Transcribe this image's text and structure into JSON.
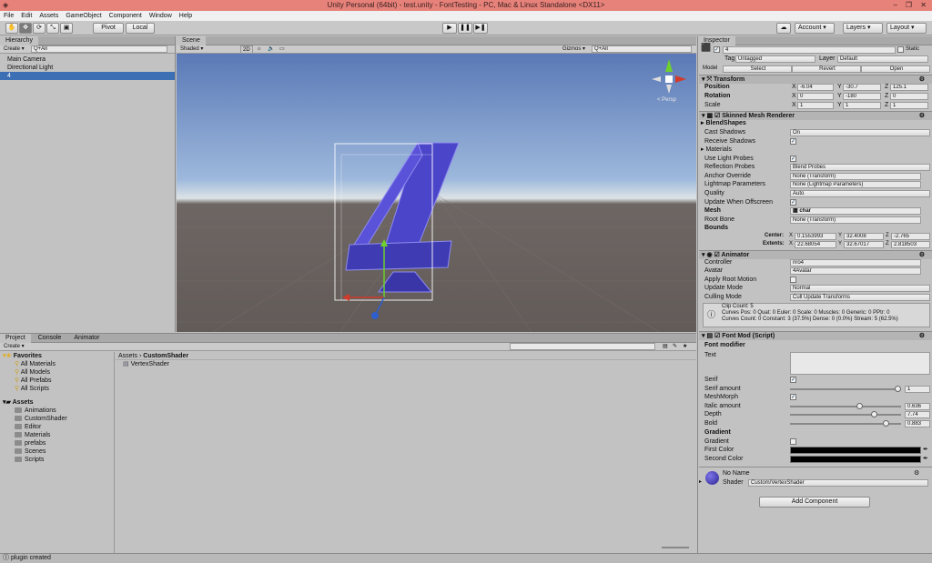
{
  "window": {
    "title": "Unity Personal (64bit) - test.unity - FontTesting - PC, Mac & Linux Standalone <DX11>"
  },
  "menu": [
    "File",
    "Edit",
    "Assets",
    "GameObject",
    "Component",
    "Window",
    "Help"
  ],
  "toolbar": {
    "pivot": "Pivot",
    "local": "Local",
    "account": "Account",
    "layers": "Layers",
    "layout": "Layout"
  },
  "hierarchy": {
    "tab": "Hierarchy",
    "create": "Create",
    "search": "Q+All",
    "items": [
      "Main Camera",
      "Directional Light",
      "4"
    ]
  },
  "scene": {
    "tab": "Scene",
    "shading": "Shaded",
    "mode2d": "2D",
    "gizmos": "Gizmos",
    "search": "Q+All",
    "persp": "< Persp"
  },
  "project": {
    "tabs": [
      "Project",
      "Console",
      "Animator"
    ],
    "create": "Create",
    "favorites_label": "Favorites",
    "favorites": [
      "All Materials",
      "All Models",
      "All Prefabs",
      "All Scripts"
    ],
    "assets_label": "Assets",
    "assets": [
      "Animations",
      "CustomShader",
      "Editor",
      "Materials",
      "prefabs",
      "Scenes",
      "Scripts"
    ],
    "breadcrumb_root": "Assets",
    "breadcrumb_sep": "›",
    "breadcrumb_folder": "CustomShader",
    "files": [
      "VertexShader"
    ]
  },
  "status": {
    "text": "plugin created"
  },
  "inspector": {
    "tab": "Inspector",
    "object_name": "4",
    "static_label": "Static",
    "tag_label": "Tag",
    "tag_value": "Untagged",
    "layer_label": "Layer",
    "layer_value": "Default",
    "model_label": "Model",
    "select": "Select",
    "revert": "Revert",
    "open": "Open",
    "transform": {
      "title": "Transform",
      "position": "Position",
      "rotation": "Rotation",
      "scale": "Scale",
      "pos": [
        "-6.04",
        "-30.7",
        "125.1"
      ],
      "rot": [
        "0",
        "-180",
        "0"
      ],
      "scl": [
        "1",
        "1",
        "1"
      ]
    },
    "smr": {
      "title": "Skinned Mesh Renderer",
      "blendshapes": "BlendShapes",
      "cast_shadows": "Cast Shadows",
      "cast_val": "On",
      "receive": "Receive Shadows",
      "materials": "Materials",
      "light_probes": "Use Light Probes",
      "refl_probes": "Reflection Probes",
      "refl_val": "Blend Probes",
      "anchor": "Anchor Override",
      "anchor_val": "None (Transform)",
      "lightmap": "Lightmap Parameters",
      "lightmap_val": "None (Lightmap Parameters)",
      "quality": "Quality",
      "quality_val": "Auto",
      "update_off": "Update When Offscreen",
      "mesh": "Mesh",
      "mesh_val": "char",
      "root_bone": "Root Bone",
      "root_val": "None (Transform)",
      "bounds": "Bounds",
      "center": "Center:",
      "extents": "Extents:",
      "center_vals": [
        "0.1553993",
        "32.4008",
        "-2.765"
      ],
      "extent_vals": [
        "22.68054",
        "32.67017",
        "2.818503"
      ]
    },
    "animator": {
      "title": "Animator",
      "controller": "Controller",
      "controller_val": "nro4",
      "avatar": "Avatar",
      "avatar_val": "4Avatar",
      "apply_root": "Apply Root Motion",
      "update_mode": "Update Mode",
      "update_val": "Normal",
      "culling": "Culling Mode",
      "culling_val": "Cull Update Transforms",
      "info": [
        "Clip Count: 5",
        "Curves Pos: 0 Quat: 0 Euler: 0 Scale: 0 Muscles: 0 Generic: 0 PPtr: 0",
        "Curves Count: 0 Constant: 3 (37.5%) Dense: 0 (0.0%) Stream: 5 (62.5%)"
      ]
    },
    "fontmod": {
      "title": "Font Mod (Script)",
      "heading": "Font modifier",
      "text_label": "Text",
      "serif": "Serif",
      "serif_amount": "Serif amount",
      "serif_amount_val": "1",
      "meshmorph": "MeshMorph",
      "italic": "Italic amount",
      "italic_val": "0.636",
      "depth": "Depth",
      "depth_val": "7.74",
      "bold": "Bold",
      "bold_val": "0.883",
      "gradient_heading": "Gradient",
      "gradient": "Gradient",
      "first_color": "First Color",
      "second_color": "Second Color"
    },
    "material": {
      "name": "No Name",
      "shader_label": "Shader",
      "shader_val": "Custom/VertexShader"
    },
    "add_component": "Add Component"
  },
  "slider_levels": {
    "serif_amount": 1.0,
    "italic": 0.636,
    "depth": 0.774,
    "bold": 0.883
  },
  "colors": {
    "title_bar": "#e7827a",
    "selection": "#3d6fb5",
    "mesh_blue": "#4b45c9",
    "first_color": "#000000",
    "second_color": "#000000"
  }
}
